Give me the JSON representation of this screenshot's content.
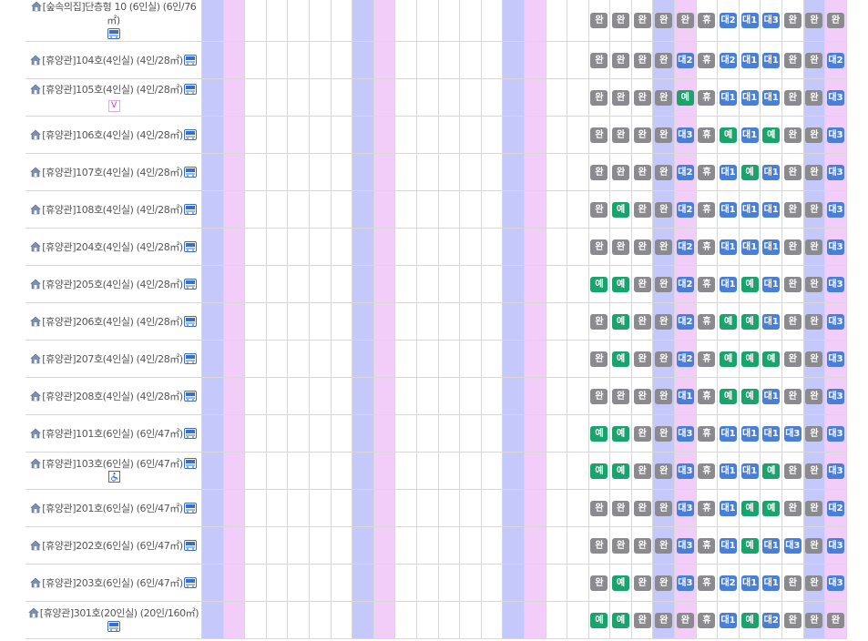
{
  "column_colors": [
    "blue",
    "pink",
    "",
    "",
    "",
    "",
    "",
    "blue",
    "pink",
    "",
    "",
    "",
    "",
    "",
    "blue",
    "pink",
    "",
    "",
    "",
    "",
    "",
    "blue",
    "pink",
    "",
    "",
    "",
    "",
    "",
    "blue",
    "pink"
  ],
  "rows": [
    {
      "name": "[숲속의집]단층형 10 (6인실) (6인/76㎡)",
      "icons": [
        "bus"
      ],
      "wrap": true,
      "status": [
        "완",
        "완",
        "완",
        "완",
        "완",
        "휴",
        "대2",
        "대1",
        "대3",
        "완",
        "완",
        "완"
      ]
    },
    {
      "name": "[휴양관]104호(4인실) (4인/28㎡)",
      "icons": [
        "bus"
      ],
      "status": [
        "완",
        "완",
        "완",
        "완",
        "대2",
        "휴",
        "대2",
        "대1",
        "대1",
        "완",
        "완",
        "대2"
      ]
    },
    {
      "name": "[휴양관]105호(4인실) (4인/28㎡)",
      "icons": [
        "bus",
        "v"
      ],
      "status": [
        "완",
        "완",
        "완",
        "완",
        "예",
        "휴",
        "대1",
        "대1",
        "대1",
        "완",
        "완",
        "대3"
      ]
    },
    {
      "name": "[휴양관]106호(4인실) (4인/28㎡)",
      "icons": [
        "bus"
      ],
      "status": [
        "완",
        "완",
        "완",
        "완",
        "대3",
        "휴",
        "예",
        "대1",
        "예",
        "완",
        "완",
        "대3"
      ]
    },
    {
      "name": "[휴양관]107호(4인실) (4인/28㎡)",
      "icons": [
        "bus"
      ],
      "status": [
        "완",
        "완",
        "완",
        "완",
        "대2",
        "휴",
        "대1",
        "예",
        "대1",
        "완",
        "완",
        "대3"
      ]
    },
    {
      "name": "[휴양관]108호(4인실) (4인/28㎡)",
      "icons": [
        "bus"
      ],
      "status": [
        "완",
        "예",
        "완",
        "완",
        "대2",
        "휴",
        "대1",
        "대1",
        "대1",
        "완",
        "완",
        "대3"
      ]
    },
    {
      "name": "[휴양관]204호(4인실) (4인/28㎡)",
      "icons": [
        "bus"
      ],
      "status": [
        "완",
        "완",
        "완",
        "완",
        "대2",
        "휴",
        "대1",
        "대1",
        "대1",
        "완",
        "완",
        "대3"
      ]
    },
    {
      "name": "[휴양관]205호(4인실) (4인/28㎡)",
      "icons": [
        "bus"
      ],
      "status": [
        "예",
        "예",
        "완",
        "완",
        "대2",
        "휴",
        "대1",
        "예",
        "대1",
        "완",
        "완",
        "대3"
      ]
    },
    {
      "name": "[휴양관]206호(4인실) (4인/28㎡)",
      "icons": [
        "bus"
      ],
      "status": [
        "완",
        "예",
        "완",
        "완",
        "대2",
        "휴",
        "예",
        "예",
        "대1",
        "완",
        "완",
        "대3"
      ]
    },
    {
      "name": "[휴양관]207호(4인실) (4인/28㎡)",
      "icons": [
        "bus"
      ],
      "status": [
        "완",
        "예",
        "완",
        "완",
        "대2",
        "휴",
        "예",
        "예",
        "예",
        "완",
        "완",
        "대3"
      ]
    },
    {
      "name": "[휴양관]208호(4인실) (4인/28㎡)",
      "icons": [
        "bus"
      ],
      "status": [
        "완",
        "완",
        "완",
        "완",
        "대1",
        "휴",
        "예",
        "예",
        "대1",
        "완",
        "완",
        "대3"
      ]
    },
    {
      "name": "[휴양관]101호(6인실) (6인/47㎡)",
      "icons": [
        "bus"
      ],
      "status": [
        "예",
        "예",
        "완",
        "완",
        "대3",
        "휴",
        "대1",
        "대1",
        "대1",
        "대3",
        "완",
        "대3"
      ]
    },
    {
      "name": "[휴양관]103호(6인실) (6인/47㎡)",
      "icons": [
        "bus",
        "wheelchair"
      ],
      "status": [
        "예",
        "예",
        "완",
        "완",
        "대3",
        "휴",
        "대1",
        "대1",
        "예",
        "완",
        "완",
        "대3"
      ]
    },
    {
      "name": "[휴양관]201호(6인실) (6인/47㎡)",
      "icons": [
        "bus"
      ],
      "status": [
        "완",
        "완",
        "완",
        "완",
        "대3",
        "휴",
        "대1",
        "예",
        "예",
        "완",
        "완",
        "대2"
      ]
    },
    {
      "name": "[휴양관]202호(6인실) (6인/47㎡)",
      "icons": [
        "bus"
      ],
      "status": [
        "완",
        "완",
        "완",
        "완",
        "대3",
        "휴",
        "대1",
        "예",
        "대1",
        "대3",
        "완",
        "대3"
      ]
    },
    {
      "name": "[휴양관]203호(6인실) (6인/47㎡)",
      "icons": [
        "bus"
      ],
      "status": [
        "완",
        "예",
        "완",
        "완",
        "대3",
        "휴",
        "대2",
        "대1",
        "대1",
        "완",
        "완",
        "대3"
      ]
    },
    {
      "name": "[휴양관]301호(20인실) (20인/160㎡)",
      "icons": [
        "bus"
      ],
      "wrap": true,
      "status": [
        "예",
        "예",
        "완",
        "완",
        "완",
        "휴",
        "대1",
        "예",
        "대2",
        "완",
        "완",
        "완"
      ]
    }
  ],
  "status_colors": {
    "완": "#8a8a8f",
    "휴": "#8a8a8f",
    "예": "#1aa36c",
    "대": "#4a7fd8"
  },
  "icons": {
    "home": "home-icon",
    "bus": "shuttle-bus-icon",
    "wheelchair": "wheelchair-icon",
    "v": "v-tag-icon"
  }
}
